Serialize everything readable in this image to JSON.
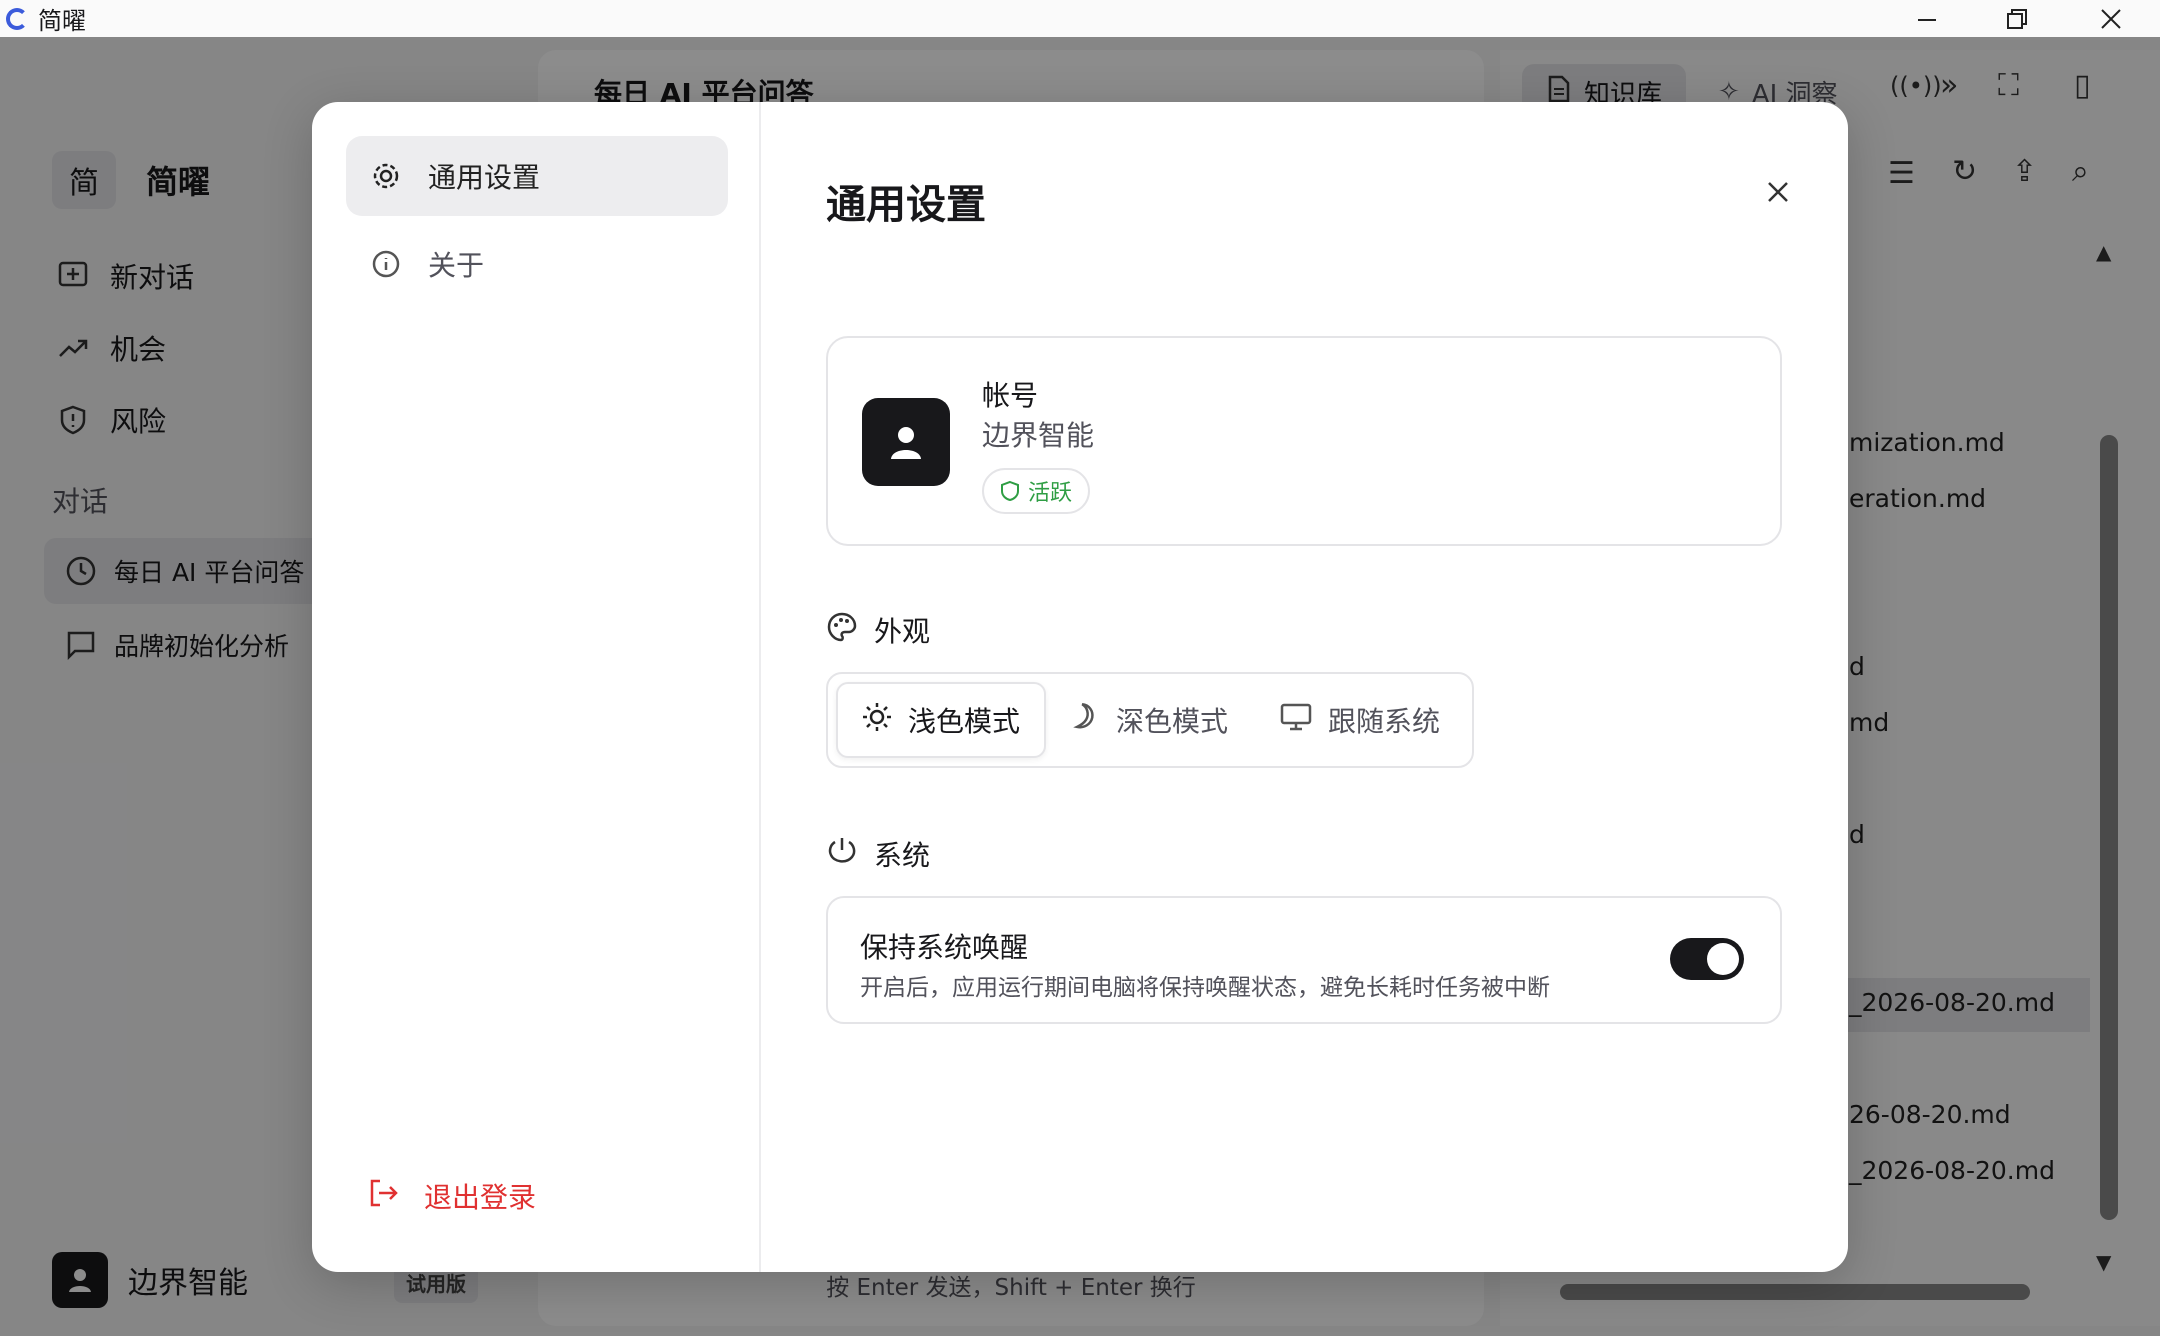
{
  "window": {
    "title": "简曜"
  },
  "sidebar": {
    "brand_mark": "简",
    "brand_name": "简曜",
    "nav": [
      {
        "label": "新对话",
        "icon": "new-chat-icon"
      },
      {
        "label": "机会",
        "icon": "trend-up-icon"
      },
      {
        "label": "风险",
        "icon": "shield-alert-icon"
      }
    ],
    "section_label": "对话",
    "conversations": [
      {
        "label": "每日 AI 平台问答",
        "icon": "clock-icon"
      },
      {
        "label": "品牌初始化分析",
        "icon": "chat-icon"
      }
    ],
    "user_name": "边界智能",
    "plan_badge": "试用版"
  },
  "main": {
    "title": "每日 AI 平台问答",
    "composer_hint": "按 Enter 发送，Shift + Enter 换行"
  },
  "right_panel": {
    "tabs": [
      {
        "label": "知识库",
        "icon": "document-icon"
      },
      {
        "label": "AI 洞察",
        "icon": "sparkle-icon"
      }
    ],
    "files": [
      "mization.md",
      "eration.md",
      "d",
      "md",
      "d",
      "_2026-08-20.md",
      "26-08-20.md",
      "_2026-08-20.md"
    ]
  },
  "modal": {
    "side_items": [
      {
        "label": "通用设置",
        "icon": "gear-icon"
      },
      {
        "label": "关于",
        "icon": "info-icon"
      }
    ],
    "logout_label": "退出登录",
    "title": "通用设置",
    "account": {
      "label": "帐号",
      "name": "边界智能",
      "status": "活跃"
    },
    "appearance": {
      "heading": "外观",
      "options": [
        "浅色模式",
        "深色模式",
        "跟随系统"
      ],
      "selected": "浅色模式"
    },
    "system": {
      "heading": "系统",
      "keep_awake_title": "保持系统唤醒",
      "keep_awake_desc": "开启后，应用运行期间电脑将保持唤醒状态，避免长耗时任务被中断",
      "keep_awake_on": true
    }
  },
  "colors": {
    "accent_dark": "#18181b",
    "danger": "#e03131",
    "success": "#2f9e44"
  }
}
